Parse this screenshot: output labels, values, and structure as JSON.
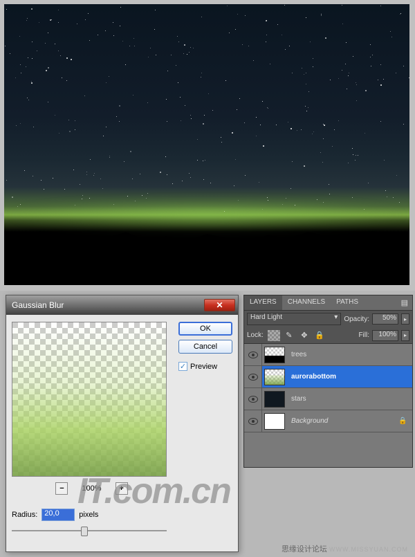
{
  "dialog": {
    "title": "Gaussian Blur",
    "zoom_level": "100%",
    "radius_label": "Radius:",
    "radius_value": "20,0",
    "radius_unit": "pixels",
    "ok_label": "OK",
    "cancel_label": "Cancel",
    "preview_label": "Preview",
    "close_glyph": "✕"
  },
  "panel": {
    "tabs": {
      "layers": "LAYERS",
      "channels": "CHANNELS",
      "paths": "PATHS"
    },
    "blend_mode": "Hard Light",
    "opacity_label": "Opacity:",
    "opacity_value": "50%",
    "lock_label": "Lock:",
    "fill_label": "Fill:",
    "fill_value": "100%",
    "layers": [
      {
        "name": "trees"
      },
      {
        "name": "aurorabottom"
      },
      {
        "name": "stars"
      },
      {
        "name": "Background"
      }
    ]
  },
  "watermark": "IT.com.cn",
  "footer": {
    "site_cn": "思缘设计论坛",
    "site_url": "WWW.MISSYUAN.COM"
  },
  "icons": {
    "minus": "−",
    "plus": "+",
    "menu": "▤",
    "dropdown": "▸",
    "brush": "✎",
    "move": "✥",
    "lock": "🔒",
    "check": "✓"
  }
}
